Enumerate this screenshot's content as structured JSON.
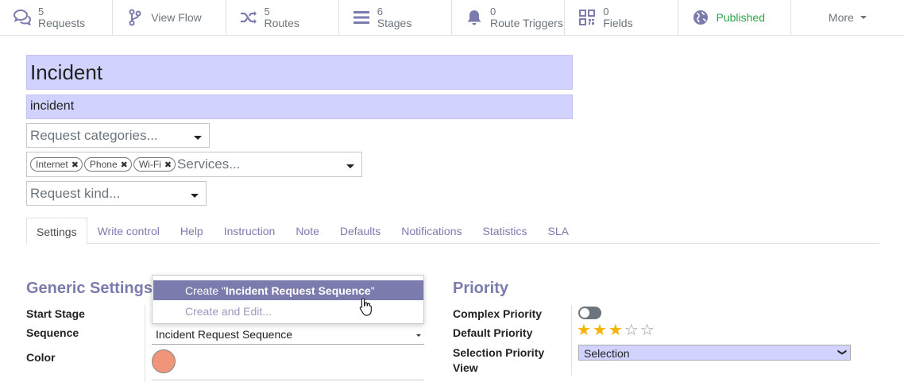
{
  "topbar": {
    "requests": {
      "count": "5",
      "label": "Requests"
    },
    "view_flow": {
      "label": "View Flow"
    },
    "routes": {
      "count": "5",
      "label": "Routes"
    },
    "stages": {
      "count": "6",
      "label": "Stages"
    },
    "route_triggers": {
      "count": "0",
      "label": "Route Triggers"
    },
    "fields": {
      "count": "0",
      "label": "Fields"
    },
    "published": {
      "label": "Published"
    },
    "more": {
      "label": "More"
    }
  },
  "header": {
    "name": "Incident",
    "code": "incident",
    "categories_placeholder": "Request categories...",
    "services_tags": [
      "Internet",
      "Phone",
      "Wi-Fi"
    ],
    "services_placeholder": "Services...",
    "kind_placeholder": "Request kind..."
  },
  "tabs": [
    "Settings",
    "Write control",
    "Help",
    "Instruction",
    "Note",
    "Defaults",
    "Notifications",
    "Statistics",
    "SLA"
  ],
  "active_tab": "Settings",
  "generic": {
    "title": "Generic Settings",
    "start_stage_label": "Start Stage",
    "sequence_label": "Sequence",
    "sequence_value": "Incident Request Sequence",
    "color_label": "Color",
    "color_value": "#f0947a"
  },
  "dropdown": {
    "create_prefix": "Create \"",
    "create_value": "Incident Request Sequence",
    "create_suffix": "\"",
    "create_edit": "Create and Edit..."
  },
  "priority": {
    "title": "Priority",
    "complex_label": "Complex Priority",
    "complex_on": false,
    "default_label": "Default Priority",
    "default_stars": 3,
    "max_stars": 5,
    "selection_label_1": "Selection Priority",
    "selection_label_2": "View",
    "selection_value": "Selection"
  },
  "colors": {
    "accent": "#7c7bad",
    "required_bg": "#d2d2ff",
    "published": "#28a745",
    "star": "#f4b400"
  }
}
